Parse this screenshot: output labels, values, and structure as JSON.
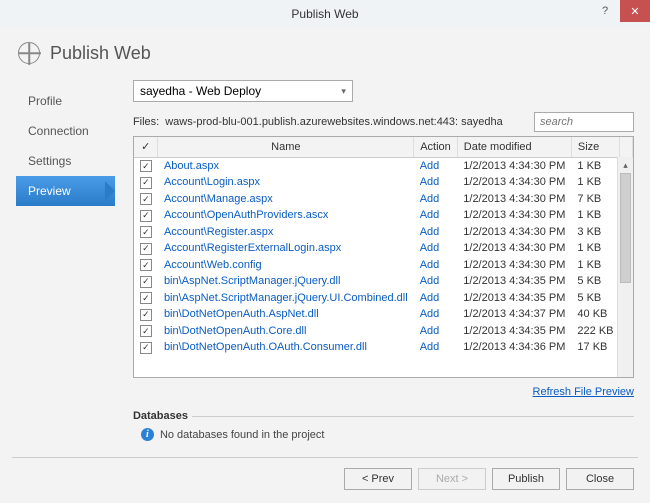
{
  "window": {
    "title": "Publish Web"
  },
  "header": {
    "title": "Publish Web"
  },
  "sidebar": {
    "items": [
      {
        "label": "Profile"
      },
      {
        "label": "Connection"
      },
      {
        "label": "Settings"
      },
      {
        "label": "Preview"
      }
    ],
    "active_index": 3
  },
  "profile_dropdown": {
    "selected": "sayedha - Web Deploy"
  },
  "files": {
    "label": "Files:",
    "target": "waws-prod-blu-001.publish.azurewebsites.windows.net:443: sayedha",
    "search_placeholder": "search"
  },
  "columns": {
    "name": "Name",
    "action": "Action",
    "date": "Date modified",
    "size": "Size"
  },
  "rows": [
    {
      "name": "About.aspx",
      "action": "Add",
      "date": "1/2/2013 4:34:30 PM",
      "size": "1 KB"
    },
    {
      "name": "Account\\Login.aspx",
      "action": "Add",
      "date": "1/2/2013 4:34:30 PM",
      "size": "1 KB"
    },
    {
      "name": "Account\\Manage.aspx",
      "action": "Add",
      "date": "1/2/2013 4:34:30 PM",
      "size": "7 KB"
    },
    {
      "name": "Account\\OpenAuthProviders.ascx",
      "action": "Add",
      "date": "1/2/2013 4:34:30 PM",
      "size": "1 KB"
    },
    {
      "name": "Account\\Register.aspx",
      "action": "Add",
      "date": "1/2/2013 4:34:30 PM",
      "size": "3 KB"
    },
    {
      "name": "Account\\RegisterExternalLogin.aspx",
      "action": "Add",
      "date": "1/2/2013 4:34:30 PM",
      "size": "1 KB"
    },
    {
      "name": "Account\\Web.config",
      "action": "Add",
      "date": "1/2/2013 4:34:30 PM",
      "size": "1 KB"
    },
    {
      "name": "bin\\AspNet.ScriptManager.jQuery.dll",
      "action": "Add",
      "date": "1/2/2013 4:34:35 PM",
      "size": "5 KB"
    },
    {
      "name": "bin\\AspNet.ScriptManager.jQuery.UI.Combined.dll",
      "action": "Add",
      "date": "1/2/2013 4:34:35 PM",
      "size": "5 KB"
    },
    {
      "name": "bin\\DotNetOpenAuth.AspNet.dll",
      "action": "Add",
      "date": "1/2/2013 4:34:37 PM",
      "size": "40 KB"
    },
    {
      "name": "bin\\DotNetOpenAuth.Core.dll",
      "action": "Add",
      "date": "1/2/2013 4:34:35 PM",
      "size": "222 KB"
    },
    {
      "name": "bin\\DotNetOpenAuth.OAuth.Consumer.dll",
      "action": "Add",
      "date": "1/2/2013 4:34:36 PM",
      "size": "17 KB"
    }
  ],
  "refresh_label": "Refresh File Preview",
  "databases": {
    "heading": "Databases",
    "message": "No databases found in the project"
  },
  "buttons": {
    "prev": "< Prev",
    "next": "Next >",
    "publish": "Publish",
    "close": "Close"
  }
}
